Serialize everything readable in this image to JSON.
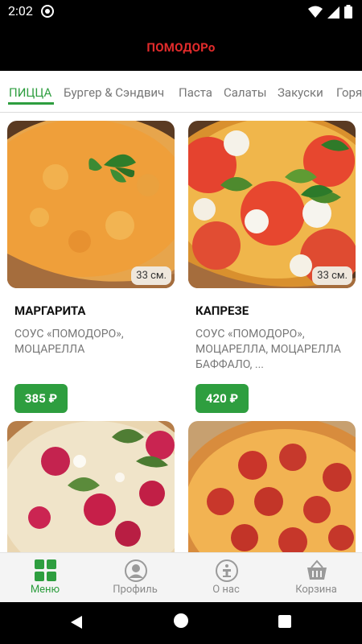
{
  "status": {
    "time": "2:02"
  },
  "header": {
    "title": "ПОМОДОРо",
    "title_color": "#e02b2b"
  },
  "tabs": [
    {
      "label": "ПИЦЦА",
      "active": true
    },
    {
      "label": "Бургер & Сэндвич",
      "active": false
    },
    {
      "label": "Паста",
      "active": false
    },
    {
      "label": "Салаты",
      "active": false
    },
    {
      "label": "Закуски",
      "active": false
    },
    {
      "label": "Горя",
      "active": false
    }
  ],
  "products": [
    {
      "name": "МАРГАРИТА",
      "description": "СОУС «ПОМОДОРО», МОЦАРЕЛЛА",
      "price": "385 ₽",
      "size": "33 см."
    },
    {
      "name": "КАПРЕЗЕ",
      "description": "СОУС «ПОМОДОРО», МОЦАРЕЛЛА, МОЦАРЕЛЛА БАФФАЛО, ...",
      "price": "420 ₽",
      "size": "33 см."
    }
  ],
  "bottom_nav": [
    {
      "label": "Меню",
      "icon": "grid-icon",
      "active": true
    },
    {
      "label": "Профиль",
      "icon": "profile-icon",
      "active": false
    },
    {
      "label": "О нас",
      "icon": "info-icon",
      "active": false
    },
    {
      "label": "Корзина",
      "icon": "basket-icon",
      "active": false
    }
  ],
  "colors": {
    "accent": "#2e9e3f",
    "header_bg": "#000000"
  }
}
